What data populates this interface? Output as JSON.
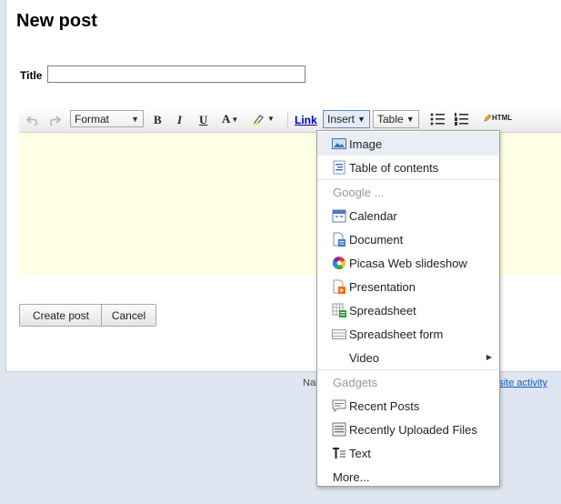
{
  "page": {
    "title": "New post"
  },
  "form": {
    "title_label": "Title",
    "title_value": ""
  },
  "toolbar": {
    "format_label": "Format",
    "bold": "B",
    "italic": "I",
    "underline": "U",
    "font_color": "A",
    "link": "Link",
    "insert": "Insert",
    "table": "Table",
    "html": "HTML"
  },
  "buttons": {
    "create": "Create post",
    "cancel": "Cancel"
  },
  "footer": {
    "left_text": "Nal",
    "right_link": "nt site activity"
  },
  "insert_menu": {
    "items": [
      {
        "label": "Image",
        "icon": "image-icon"
      },
      {
        "label": "Table of contents",
        "icon": "table-of-contents-icon"
      },
      {
        "label": "Google ...",
        "header": true
      },
      {
        "label": "Calendar",
        "icon": "calendar-icon"
      },
      {
        "label": "Document",
        "icon": "document-icon"
      },
      {
        "label": "Picasa Web slideshow",
        "icon": "picasa-icon"
      },
      {
        "label": "Presentation",
        "icon": "presentation-icon"
      },
      {
        "label": "Spreadsheet",
        "icon": "spreadsheet-icon"
      },
      {
        "label": "Spreadsheet form",
        "icon": "spreadsheet-form-icon"
      },
      {
        "label": "Video",
        "icon": "video-icon"
      },
      {
        "label": "Gadgets",
        "header": true
      },
      {
        "label": "Recent Posts",
        "icon": "recent-posts-icon"
      },
      {
        "label": "Recently Uploaded Files",
        "icon": "recently-uploaded-files-icon"
      },
      {
        "label": "Text",
        "icon": "text-icon"
      },
      {
        "label": "More...",
        "icon": ""
      }
    ]
  },
  "colors": {
    "editor_bg": "#ffffe5",
    "link": "#0000cc",
    "page_bg": "#dfe6f1",
    "menu_highlight": "#e9edf4"
  }
}
